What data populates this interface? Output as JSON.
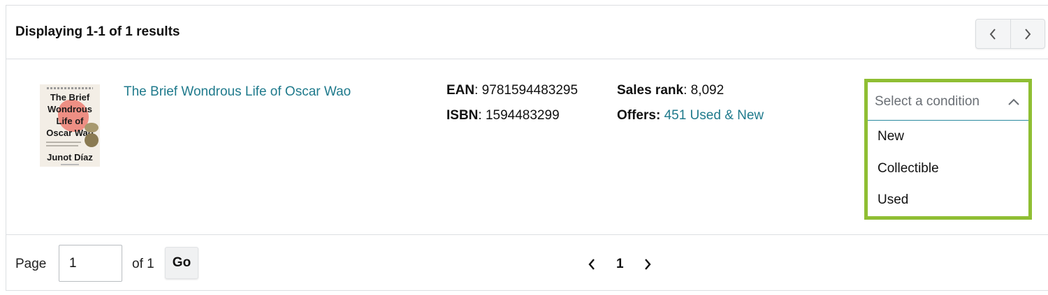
{
  "header": {
    "title": "Displaying 1-1 of 1 results",
    "prev_icon": "chevron-left-icon",
    "next_icon": "chevron-right-icon"
  },
  "result": {
    "cover": {
      "title_lines": [
        "The Brief",
        "Wondrous",
        "Life of",
        "Oscar Wao"
      ],
      "author": "Junot Díaz"
    },
    "title": "The Brief Wondrous Life of Oscar Wao",
    "ean_label": "EAN",
    "ean_value": ": 9781594483295",
    "isbn_label": "ISBN",
    "isbn_value": ": 1594483299",
    "sales_rank_label": "Sales rank",
    "sales_rank_value": ": 8,092",
    "offers_label": "Offers:",
    "offers_link": "451 Used & New"
  },
  "condition": {
    "placeholder": "Select a condition",
    "options": [
      "New",
      "Collectible",
      "Used"
    ],
    "highlight_color": "#8fbe33"
  },
  "footer": {
    "page_label": "Page",
    "page_value": "1",
    "of_label": "of 1",
    "go_label": "Go",
    "current_page": "1"
  },
  "colors": {
    "link": "#1f7a8c",
    "border": "#dcdfe2"
  }
}
